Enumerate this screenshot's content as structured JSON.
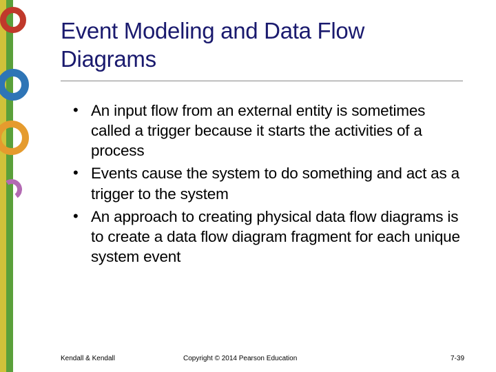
{
  "title": "Event Modeling and Data Flow Diagrams",
  "bullets": [
    "An input flow from an external entity is sometimes called a trigger because it starts the activities of a process",
    "Events cause the system to do something and act as a trigger to the system",
    "An approach to creating physical data flow diagrams is to create a data flow diagram fragment for each unique system event"
  ],
  "footer": {
    "author": "Kendall & Kendall",
    "copyright": "Copyright © 2014 Pearson Education",
    "page": "7-39"
  }
}
